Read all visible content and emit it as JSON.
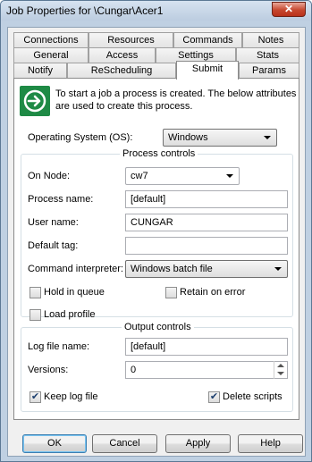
{
  "window": {
    "title": "Job Properties for \\Cungar\\Acer1",
    "close_glyph": "✕"
  },
  "tabs": {
    "row1": [
      "Connections",
      "Resources",
      "Commands",
      "Notes"
    ],
    "row2": [
      "General",
      "Access",
      "Settings",
      "Stats"
    ],
    "row3": [
      "Notify",
      "ReScheduling",
      "Submit",
      "Params"
    ],
    "active": "Submit"
  },
  "info": {
    "icon": "arrow-right-circle-icon",
    "icon_color": "#1e8a45",
    "text": "To start a job a process is created.  The below attributes are used to create this process."
  },
  "os": {
    "label": "Operating System (OS):",
    "value": "Windows"
  },
  "process_controls": {
    "title": "Process controls",
    "on_node_label": "On Node:",
    "on_node_value": "cw7",
    "process_name_label": "Process name:",
    "process_name_value": "[default]",
    "user_name_label": "User name:",
    "user_name_value": "CUNGAR",
    "default_tag_label": "Default tag:",
    "default_tag_value": "",
    "interpreter_label": "Command interpreter:",
    "interpreter_value": "Windows batch file",
    "hold_in_queue_label": "Hold in queue",
    "hold_in_queue_checked": false,
    "retain_on_error_label": "Retain on error",
    "retain_on_error_checked": false,
    "load_profile_label": "Load profile",
    "load_profile_checked": false
  },
  "output_controls": {
    "title": "Output controls",
    "log_file_label": "Log file name:",
    "log_file_value": "[default]",
    "versions_label": "Versions:",
    "versions_value": "0",
    "keep_log_label": "Keep log file",
    "keep_log_checked": true,
    "delete_scripts_label": "Delete scripts",
    "delete_scripts_checked": true
  },
  "buttons": {
    "ok": "OK",
    "cancel": "Cancel",
    "apply": "Apply",
    "help": "Help"
  }
}
